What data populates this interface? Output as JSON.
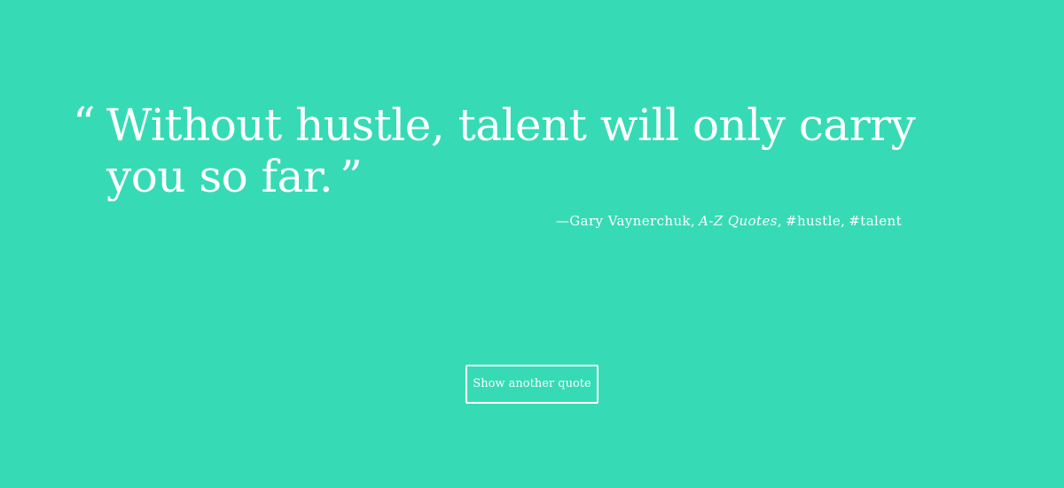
{
  "quote": {
    "open_mark": "“",
    "text": "Without hustle, talent will only carry you so far.",
    "close_mark": "”"
  },
  "attribution": {
    "dash": "—",
    "author": "Gary Vaynerchuk",
    "separator": ",",
    "source": "A-Z Quotes",
    "tags": [
      "#hustle",
      "#talent"
    ]
  },
  "actions": {
    "show_another_label": "Show another quote"
  },
  "colors": {
    "background": "#36dbb5",
    "text": "#ffffff"
  }
}
